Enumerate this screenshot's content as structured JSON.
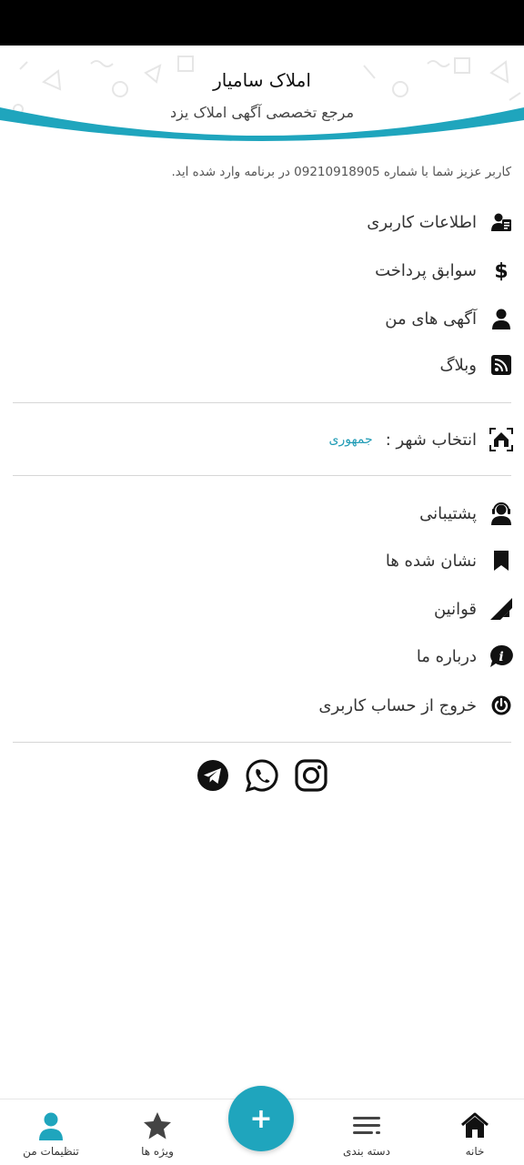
{
  "header": {
    "title": "املاک سامیار",
    "subtitle": "مرجع تخصصی آگهی املاک یزد"
  },
  "notice": "کاربر عزیز شما با شماره 09210918905 در برنامه وارد شده اید.",
  "menu_group_1": [
    {
      "label": "اطلاعات کاربری",
      "icon": "user-info-icon"
    },
    {
      "label": "سوابق پرداخت",
      "icon": "dollar-icon"
    },
    {
      "label": "آگهی های من",
      "icon": "person-icon"
    },
    {
      "label": "وبلاگ",
      "icon": "rss-icon"
    }
  ],
  "city": {
    "label": "انتخاب شهر :",
    "value": "جمهوری",
    "icon": "home-scan-icon"
  },
  "menu_group_2": [
    {
      "label": "پشتیبانی",
      "icon": "support-headset-icon"
    },
    {
      "label": "نشان شده ها",
      "icon": "bookmark-icon"
    },
    {
      "label": "قوانین",
      "icon": "ruler-icon"
    },
    {
      "label": "درباره ما",
      "icon": "info-chat-icon"
    },
    {
      "label": "خروج از حساب کاربری",
      "icon": "power-icon"
    }
  ],
  "social": [
    "telegram-icon",
    "whatsapp-icon",
    "instagram-icon"
  ],
  "bottom_nav": {
    "home": "خانه",
    "categories": "دسته بندی",
    "add": "+",
    "special": "ویژه ها",
    "settings": "تنظیمات من"
  },
  "colors": {
    "accent": "#1fa5bd",
    "city_value": "#1f9bb5",
    "icon": "#111111"
  }
}
